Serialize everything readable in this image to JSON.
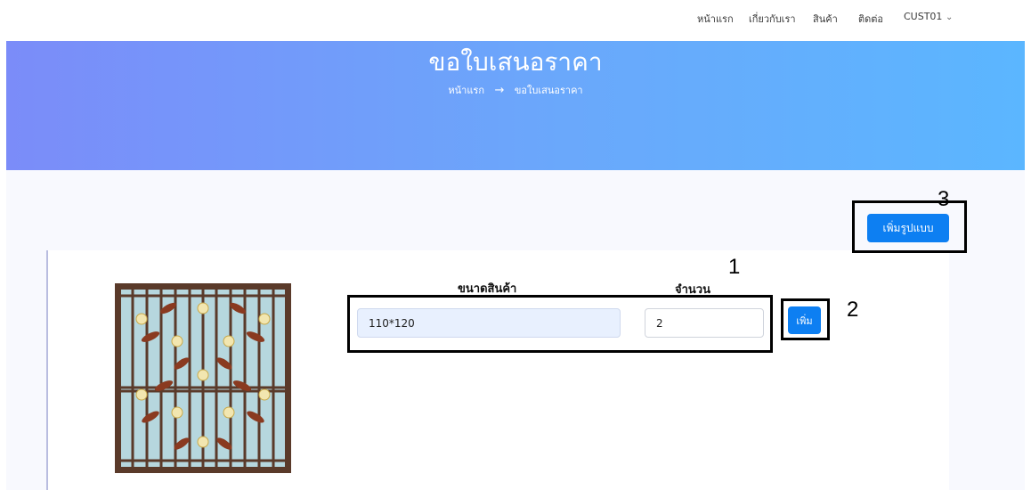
{
  "nav": {
    "items": [
      "หน้าแรก",
      "เกี่ยวกับเรา",
      "สินค้า",
      "ติดต่อ"
    ],
    "user": "CUST01",
    "chevron": "⌄"
  },
  "hero": {
    "title": "ขอใบเสนอราคา",
    "breadcrumb_home": "หน้าแรก",
    "breadcrumb_arrow": "→",
    "breadcrumb_current": "ขอใบเสนอราคา"
  },
  "actions": {
    "add_pattern_label": "เพิ่มรูปแบบ"
  },
  "item": {
    "image_icon": "window-grille-image",
    "size_label": "ขนาดสินค้า",
    "qty_label": "จำนวน",
    "size_value": "110*120",
    "qty_value": "2",
    "add_label": "เพิ่ม"
  },
  "annotations": [
    "1",
    "2",
    "3"
  ]
}
